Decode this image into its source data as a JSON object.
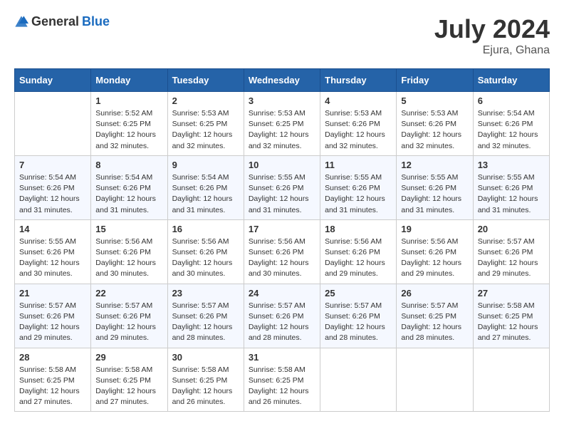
{
  "header": {
    "logo_general": "General",
    "logo_blue": "Blue",
    "month_year": "July 2024",
    "location": "Ejura, Ghana"
  },
  "calendar": {
    "days_of_week": [
      "Sunday",
      "Monday",
      "Tuesday",
      "Wednesday",
      "Thursday",
      "Friday",
      "Saturday"
    ],
    "weeks": [
      [
        {
          "day": "",
          "sunrise": "",
          "sunset": "",
          "daylight": ""
        },
        {
          "day": "1",
          "sunrise": "Sunrise: 5:52 AM",
          "sunset": "Sunset: 6:25 PM",
          "daylight": "Daylight: 12 hours and 32 minutes."
        },
        {
          "day": "2",
          "sunrise": "Sunrise: 5:53 AM",
          "sunset": "Sunset: 6:25 PM",
          "daylight": "Daylight: 12 hours and 32 minutes."
        },
        {
          "day": "3",
          "sunrise": "Sunrise: 5:53 AM",
          "sunset": "Sunset: 6:25 PM",
          "daylight": "Daylight: 12 hours and 32 minutes."
        },
        {
          "day": "4",
          "sunrise": "Sunrise: 5:53 AM",
          "sunset": "Sunset: 6:26 PM",
          "daylight": "Daylight: 12 hours and 32 minutes."
        },
        {
          "day": "5",
          "sunrise": "Sunrise: 5:53 AM",
          "sunset": "Sunset: 6:26 PM",
          "daylight": "Daylight: 12 hours and 32 minutes."
        },
        {
          "day": "6",
          "sunrise": "Sunrise: 5:54 AM",
          "sunset": "Sunset: 6:26 PM",
          "daylight": "Daylight: 12 hours and 32 minutes."
        }
      ],
      [
        {
          "day": "7",
          "sunrise": "Sunrise: 5:54 AM",
          "sunset": "Sunset: 6:26 PM",
          "daylight": "Daylight: 12 hours and 31 minutes."
        },
        {
          "day": "8",
          "sunrise": "Sunrise: 5:54 AM",
          "sunset": "Sunset: 6:26 PM",
          "daylight": "Daylight: 12 hours and 31 minutes."
        },
        {
          "day": "9",
          "sunrise": "Sunrise: 5:54 AM",
          "sunset": "Sunset: 6:26 PM",
          "daylight": "Daylight: 12 hours and 31 minutes."
        },
        {
          "day": "10",
          "sunrise": "Sunrise: 5:55 AM",
          "sunset": "Sunset: 6:26 PM",
          "daylight": "Daylight: 12 hours and 31 minutes."
        },
        {
          "day": "11",
          "sunrise": "Sunrise: 5:55 AM",
          "sunset": "Sunset: 6:26 PM",
          "daylight": "Daylight: 12 hours and 31 minutes."
        },
        {
          "day": "12",
          "sunrise": "Sunrise: 5:55 AM",
          "sunset": "Sunset: 6:26 PM",
          "daylight": "Daylight: 12 hours and 31 minutes."
        },
        {
          "day": "13",
          "sunrise": "Sunrise: 5:55 AM",
          "sunset": "Sunset: 6:26 PM",
          "daylight": "Daylight: 12 hours and 31 minutes."
        }
      ],
      [
        {
          "day": "14",
          "sunrise": "Sunrise: 5:55 AM",
          "sunset": "Sunset: 6:26 PM",
          "daylight": "Daylight: 12 hours and 30 minutes."
        },
        {
          "day": "15",
          "sunrise": "Sunrise: 5:56 AM",
          "sunset": "Sunset: 6:26 PM",
          "daylight": "Daylight: 12 hours and 30 minutes."
        },
        {
          "day": "16",
          "sunrise": "Sunrise: 5:56 AM",
          "sunset": "Sunset: 6:26 PM",
          "daylight": "Daylight: 12 hours and 30 minutes."
        },
        {
          "day": "17",
          "sunrise": "Sunrise: 5:56 AM",
          "sunset": "Sunset: 6:26 PM",
          "daylight": "Daylight: 12 hours and 30 minutes."
        },
        {
          "day": "18",
          "sunrise": "Sunrise: 5:56 AM",
          "sunset": "Sunset: 6:26 PM",
          "daylight": "Daylight: 12 hours and 29 minutes."
        },
        {
          "day": "19",
          "sunrise": "Sunrise: 5:56 AM",
          "sunset": "Sunset: 6:26 PM",
          "daylight": "Daylight: 12 hours and 29 minutes."
        },
        {
          "day": "20",
          "sunrise": "Sunrise: 5:57 AM",
          "sunset": "Sunset: 6:26 PM",
          "daylight": "Daylight: 12 hours and 29 minutes."
        }
      ],
      [
        {
          "day": "21",
          "sunrise": "Sunrise: 5:57 AM",
          "sunset": "Sunset: 6:26 PM",
          "daylight": "Daylight: 12 hours and 29 minutes."
        },
        {
          "day": "22",
          "sunrise": "Sunrise: 5:57 AM",
          "sunset": "Sunset: 6:26 PM",
          "daylight": "Daylight: 12 hours and 29 minutes."
        },
        {
          "day": "23",
          "sunrise": "Sunrise: 5:57 AM",
          "sunset": "Sunset: 6:26 PM",
          "daylight": "Daylight: 12 hours and 28 minutes."
        },
        {
          "day": "24",
          "sunrise": "Sunrise: 5:57 AM",
          "sunset": "Sunset: 6:26 PM",
          "daylight": "Daylight: 12 hours and 28 minutes."
        },
        {
          "day": "25",
          "sunrise": "Sunrise: 5:57 AM",
          "sunset": "Sunset: 6:26 PM",
          "daylight": "Daylight: 12 hours and 28 minutes."
        },
        {
          "day": "26",
          "sunrise": "Sunrise: 5:57 AM",
          "sunset": "Sunset: 6:25 PM",
          "daylight": "Daylight: 12 hours and 28 minutes."
        },
        {
          "day": "27",
          "sunrise": "Sunrise: 5:58 AM",
          "sunset": "Sunset: 6:25 PM",
          "daylight": "Daylight: 12 hours and 27 minutes."
        }
      ],
      [
        {
          "day": "28",
          "sunrise": "Sunrise: 5:58 AM",
          "sunset": "Sunset: 6:25 PM",
          "daylight": "Daylight: 12 hours and 27 minutes."
        },
        {
          "day": "29",
          "sunrise": "Sunrise: 5:58 AM",
          "sunset": "Sunset: 6:25 PM",
          "daylight": "Daylight: 12 hours and 27 minutes."
        },
        {
          "day": "30",
          "sunrise": "Sunrise: 5:58 AM",
          "sunset": "Sunset: 6:25 PM",
          "daylight": "Daylight: 12 hours and 26 minutes."
        },
        {
          "day": "31",
          "sunrise": "Sunrise: 5:58 AM",
          "sunset": "Sunset: 6:25 PM",
          "daylight": "Daylight: 12 hours and 26 minutes."
        },
        {
          "day": "",
          "sunrise": "",
          "sunset": "",
          "daylight": ""
        },
        {
          "day": "",
          "sunrise": "",
          "sunset": "",
          "daylight": ""
        },
        {
          "day": "",
          "sunrise": "",
          "sunset": "",
          "daylight": ""
        }
      ]
    ]
  }
}
